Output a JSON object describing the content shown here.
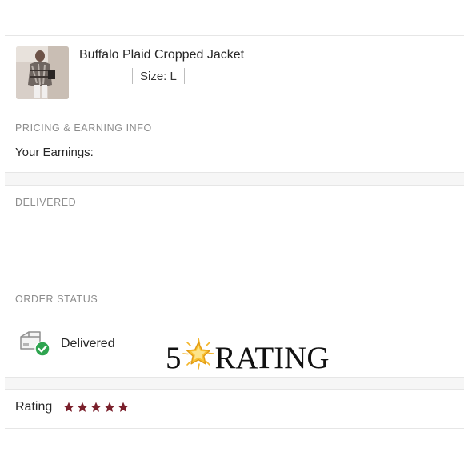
{
  "product": {
    "title": "Buffalo Plaid Cropped Jacket",
    "size": "Size: L"
  },
  "pricing": {
    "section_label": "PRICING & EARNING INFO",
    "earnings_label": "Your Earnings:"
  },
  "delivered": {
    "section_label": "DELIVERED"
  },
  "order_status": {
    "section_label": "ORDER STATUS",
    "status": "Delivered",
    "status_icon": "package-delivered-icon",
    "check_color": "#2ea44f"
  },
  "overlay": {
    "number": "5",
    "emoji_icon": "glowing-star-icon",
    "word": "RATING"
  },
  "rating": {
    "label": "Rating",
    "stars": 5,
    "max_stars": 5,
    "star_color": "#7a1f2b"
  }
}
